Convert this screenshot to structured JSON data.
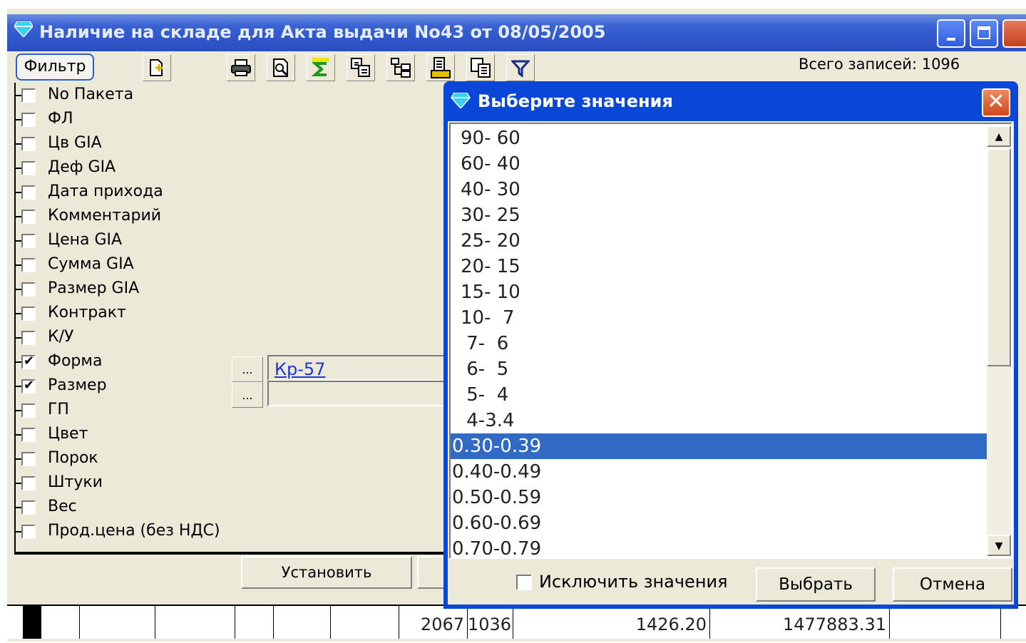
{
  "window": {
    "title": "Наличие на складе для Акта выдачи No43 от 08/05/2005",
    "total_label": "Всего записей: 1096"
  },
  "toolbar": {
    "filter_label": "Фильтр",
    "icons": [
      "add-doc-icon",
      "print-icon",
      "preview-icon",
      "sum-icon",
      "export-icon",
      "tree-icon",
      "copy-icon",
      "duplicate-icon",
      "filter-funnel-icon"
    ]
  },
  "fields": [
    {
      "label": "No Пакета",
      "checked": false
    },
    {
      "label": "ФЛ",
      "checked": false
    },
    {
      "label": "Цв GIA",
      "checked": false
    },
    {
      "label": "Деф GIA",
      "checked": false
    },
    {
      "label": "Дата прихода",
      "checked": false
    },
    {
      "label": "Комментарий",
      "checked": false
    },
    {
      "label": "Цена GIA",
      "checked": false
    },
    {
      "label": "Сумма GIA",
      "checked": false
    },
    {
      "label": "Размер GIA",
      "checked": false
    },
    {
      "label": "Контракт",
      "checked": false
    },
    {
      "label": "К/У",
      "checked": false
    },
    {
      "label": "Форма",
      "checked": true,
      "value": "Кр-57"
    },
    {
      "label": "Размер",
      "checked": true,
      "value": ""
    },
    {
      "label": "ГП",
      "checked": false
    },
    {
      "label": "Цвет",
      "checked": false
    },
    {
      "label": "Порок",
      "checked": false
    },
    {
      "label": "Штуки",
      "checked": false
    },
    {
      "label": "Вес",
      "checked": false
    },
    {
      "label": "Прод.цена (без НДС)",
      "checked": false
    }
  ],
  "ellipsis_label": "...",
  "set_button": "Установить",
  "totals": [
    "2067",
    "1036",
    "1426.20",
    "1477883.31"
  ],
  "dialog": {
    "title": "Выберите значения",
    "items": [
      "90- 60",
      "60- 40",
      "40- 30",
      "30- 25",
      "25- 20",
      "20- 15",
      "15- 10",
      "10-  7",
      " 7-  6",
      " 6-  5",
      " 5-  4",
      " 4-3.4",
      "0.30-0.39",
      "0.40-0.49",
      "0.50-0.59",
      "0.60-0.69",
      "0.70-0.79"
    ],
    "selected_index": 12,
    "exclude_label": "Исключить значения",
    "ok_label": "Выбрать",
    "cancel_label": "Отмена",
    "colors": {
      "title": "#0a47d6",
      "selection": "#316ac5"
    }
  }
}
